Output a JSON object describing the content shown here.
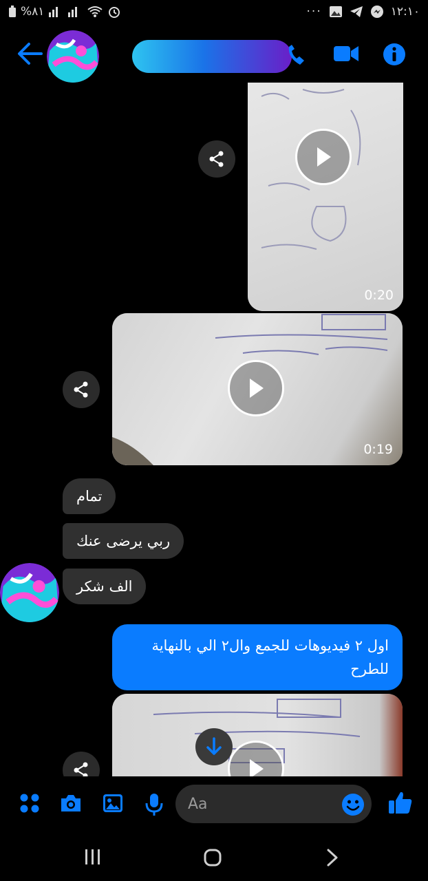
{
  "status_bar": {
    "battery": "%٨١",
    "time": "١٢:١٠",
    "dots": "···"
  },
  "header": {
    "contact_name": "",
    "icons": [
      "back-arrow-icon",
      "phone-icon",
      "video-call-icon",
      "info-icon"
    ]
  },
  "messages": {
    "video1_duration": "0:20",
    "video2_duration": "0:19",
    "incoming": [
      "تمام",
      "ربي يرضى عنك",
      "الف شكر"
    ],
    "outgoing_text": "اول ٢ فيديوهات للجمع وال٢ الي بالنهاية للطرح"
  },
  "composer": {
    "placeholder": "Aa",
    "icons": [
      "apps-icon",
      "camera-icon",
      "gallery-icon",
      "mic-icon",
      "emoji-icon",
      "thumbs-up-icon"
    ]
  },
  "colors": {
    "accent": "#0a7cff",
    "incoming_bubble": "#303030",
    "background": "#000000"
  }
}
